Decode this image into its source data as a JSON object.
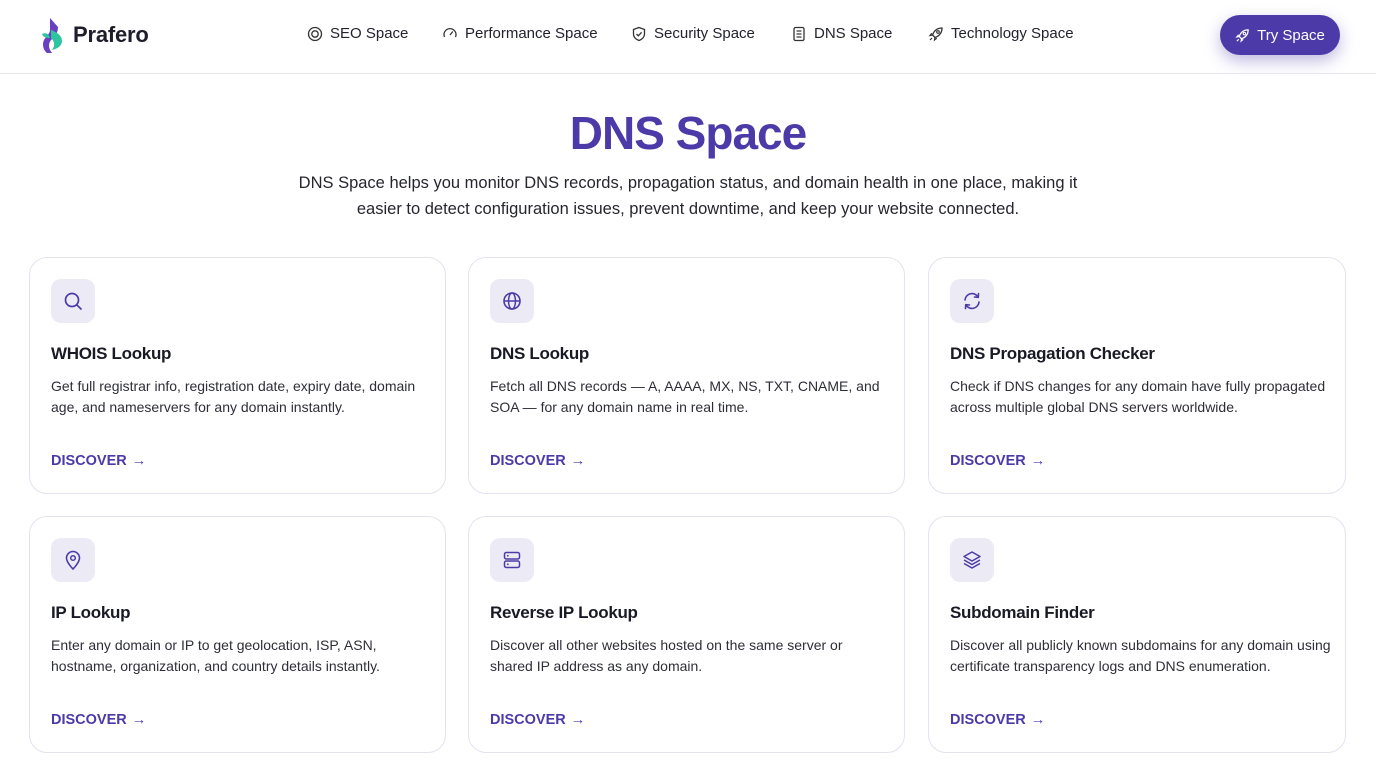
{
  "brand": {
    "name": "Prafero"
  },
  "nav": {
    "items": [
      {
        "label": "SEO Space",
        "icon": "target-icon"
      },
      {
        "label": "Performance Space",
        "icon": "gauge-icon"
      },
      {
        "label": "Security Space",
        "icon": "shield-icon"
      },
      {
        "label": "DNS Space",
        "icon": "document-icon"
      },
      {
        "label": "Technology Space",
        "icon": "rocket-icon"
      }
    ],
    "cta_label": "Try Space"
  },
  "hero": {
    "title": "DNS Space",
    "description": "DNS Space helps you monitor DNS records, propagation status, and domain health in one place, making it easier to detect configuration issues, prevent downtime, and keep your website connected."
  },
  "cards": [
    {
      "title": "WHOIS Lookup",
      "description": "Get full registrar info, registration date, expiry date, domain age, and nameservers for any domain instantly.",
      "link": "DISCOVER",
      "icon": "search-icon"
    },
    {
      "title": "DNS Lookup",
      "description": "Fetch all DNS records — A, AAAA, MX, NS, TXT, CNAME, and SOA — for any domain name in real time.",
      "link": "DISCOVER",
      "icon": "globe-icon"
    },
    {
      "title": "DNS Propagation Checker",
      "description": "Check if DNS changes for any domain have fully propagated across multiple global DNS servers worldwide.",
      "link": "DISCOVER",
      "icon": "refresh-icon"
    },
    {
      "title": "IP Lookup",
      "description": "Enter any domain or IP to get geolocation, ISP, ASN, hostname, organization, and country details instantly.",
      "link": "DISCOVER",
      "icon": "map-pin-icon"
    },
    {
      "title": "Reverse IP Lookup",
      "description": "Discover all other websites hosted on the same server or shared IP address as any domain.",
      "link": "DISCOVER",
      "icon": "server-icon"
    },
    {
      "title": "Subdomain Finder",
      "description": "Discover all publicly known subdomains for any domain using certificate transparency logs and DNS enumeration.",
      "link": "DISCOVER",
      "icon": "layers-icon"
    }
  ],
  "colors": {
    "accent": "#4b3aa8",
    "icon_bg": "#ecebf5",
    "logo_green": "#2ec4a0",
    "logo_purple": "#6a3fc2"
  }
}
